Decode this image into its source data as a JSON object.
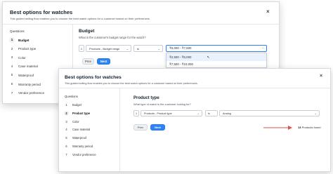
{
  "back_dialog": {
    "title": "Best options for watches",
    "subtitle": "This guided selling flow enables you to choose the best watch options for a customer based on their preferences.",
    "questions_label": "Questions",
    "steps": [
      {
        "num": "1",
        "label": "Budget"
      },
      {
        "num": "2",
        "label": "Product type"
      },
      {
        "num": "3",
        "label": "Color"
      },
      {
        "num": "4",
        "label": "Case material"
      },
      {
        "num": "5",
        "label": "Waterproof"
      },
      {
        "num": "6",
        "label": "Warranty period"
      },
      {
        "num": "7",
        "label": "Vendor preference"
      }
    ],
    "section_title": "Budget",
    "section_question": "What is the customer's budget range for the watch?",
    "row": {
      "num": "1",
      "field": "Products - Budget range",
      "operator": "is",
      "value": "₹5,000 - ₹7,500"
    },
    "dropdown_options": [
      "₹2,500 - ₹5,000",
      "₹7,500 - ₹10,000"
    ],
    "prev_label": "Prev",
    "next_label": "Next"
  },
  "front_dialog": {
    "title": "Best options for watches",
    "subtitle": "This guided selling flow enables you to choose the best watch options for a customer based on their preferences.",
    "questions_label": "Questions",
    "steps": [
      {
        "num": "1",
        "label": "Budget"
      },
      {
        "num": "2",
        "label": "Product type"
      },
      {
        "num": "3",
        "label": "Color"
      },
      {
        "num": "4",
        "label": "Case material"
      },
      {
        "num": "5",
        "label": "Waterproof"
      },
      {
        "num": "6",
        "label": "Warranty period"
      },
      {
        "num": "7",
        "label": "Vendor preference"
      }
    ],
    "section_title": "Product type",
    "section_question": "What type of watch is the customer looking for?",
    "row": {
      "num": "1",
      "field": "Products - Product type",
      "operator": "is",
      "value": "Analog"
    },
    "prev_label": "Prev",
    "next_label": "Next",
    "products_found_count": "13",
    "products_found_label": "Products found"
  },
  "colors": {
    "accent": "#2f84f5",
    "arrow": "#d9534f"
  }
}
